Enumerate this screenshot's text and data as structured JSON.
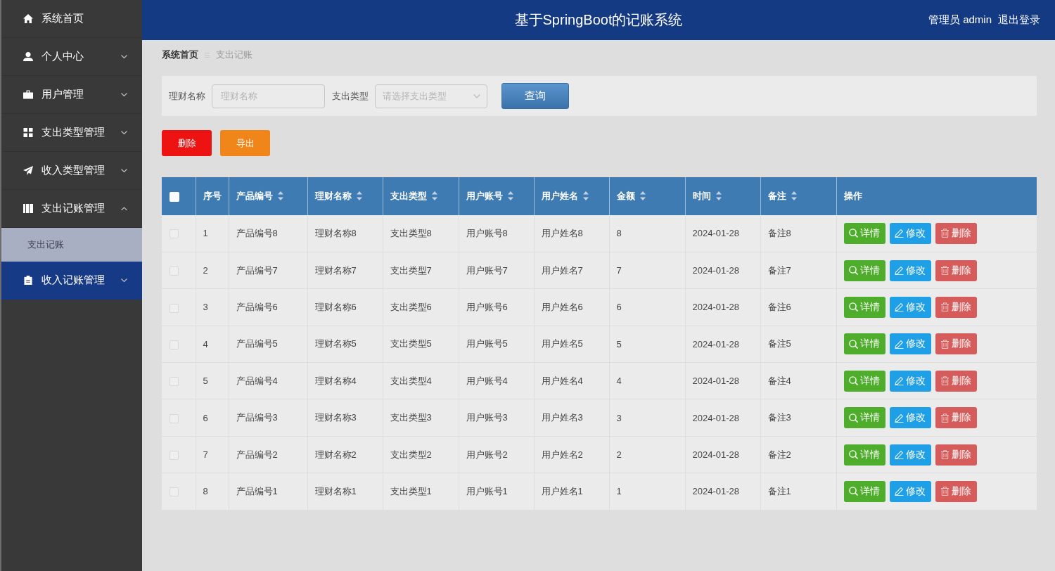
{
  "sidebar": {
    "items": [
      {
        "label": "系统首页",
        "kind": "link",
        "hovered": false
      },
      {
        "label": "个人中心",
        "kind": "menu",
        "expanded": false,
        "hovered": false
      },
      {
        "label": "用户管理",
        "kind": "menu",
        "expanded": false,
        "hovered": false
      },
      {
        "label": "支出类型管理",
        "kind": "menu",
        "expanded": false,
        "hovered": false
      },
      {
        "label": "收入类型管理",
        "kind": "menu",
        "expanded": false,
        "hovered": false
      },
      {
        "label": "支出记账管理",
        "kind": "menu",
        "expanded": true,
        "hovered": false,
        "children": [
          {
            "label": "支出记账",
            "selected": true
          }
        ]
      },
      {
        "label": "收入记账管理",
        "kind": "menu",
        "expanded": false,
        "hovered": true
      }
    ]
  },
  "header": {
    "title": "基于SpringBoot的记账系统",
    "user": "管理员 admin",
    "logout": "退出登录"
  },
  "breadcrumb": [
    {
      "label": "系统首页",
      "current": false
    },
    {
      "label": "支出记账",
      "current": true
    }
  ],
  "search": {
    "fields": [
      {
        "label": "理财名称",
        "kind": "input",
        "placeholder": "理财名称"
      },
      {
        "label": "支出类型",
        "kind": "select",
        "placeholder": "请选择支出类型"
      }
    ],
    "button": "查询"
  },
  "toolbar": [
    {
      "label": "删除",
      "kind": "danger"
    },
    {
      "label": "导出",
      "kind": "warning"
    }
  ],
  "table": {
    "select_all": {
      "checked": false
    },
    "columns": [
      {
        "label": "序号",
        "sortable": false
      },
      {
        "label": "产品编号",
        "sortable": true
      },
      {
        "label": "理财名称",
        "sortable": true
      },
      {
        "label": "支出类型",
        "sortable": true
      },
      {
        "label": "用户账号",
        "sortable": true
      },
      {
        "label": "用户姓名",
        "sortable": true
      },
      {
        "label": "金额",
        "sortable": true
      },
      {
        "label": "时间",
        "sortable": true
      },
      {
        "label": "备注",
        "sortable": true
      },
      {
        "label": "操作",
        "sortable": false
      }
    ],
    "rows": [
      {
        "checked": false,
        "cells": [
          "1",
          "产品编号8",
          "理财名称8",
          "支出类型8",
          "用户账号8",
          "用户姓名8",
          "8",
          "2024-01-28",
          "备注8"
        ],
        "actions": [
          {
            "label": "详情",
            "kind": "detail"
          },
          {
            "label": "修改",
            "kind": "edit"
          },
          {
            "label": "删除",
            "kind": "delete"
          }
        ]
      },
      {
        "checked": false,
        "cells": [
          "2",
          "产品编号7",
          "理财名称7",
          "支出类型7",
          "用户账号7",
          "用户姓名7",
          "7",
          "2024-01-28",
          "备注7"
        ],
        "actions": [
          {
            "label": "详情",
            "kind": "detail"
          },
          {
            "label": "修改",
            "kind": "edit"
          },
          {
            "label": "删除",
            "kind": "delete"
          }
        ]
      },
      {
        "checked": false,
        "cells": [
          "3",
          "产品编号6",
          "理财名称6",
          "支出类型6",
          "用户账号6",
          "用户姓名6",
          "6",
          "2024-01-28",
          "备注6"
        ],
        "actions": [
          {
            "label": "详情",
            "kind": "detail"
          },
          {
            "label": "修改",
            "kind": "edit"
          },
          {
            "label": "删除",
            "kind": "delete"
          }
        ]
      },
      {
        "checked": false,
        "cells": [
          "4",
          "产品编号5",
          "理财名称5",
          "支出类型5",
          "用户账号5",
          "用户姓名5",
          "5",
          "2024-01-28",
          "备注5"
        ],
        "actions": [
          {
            "label": "详情",
            "kind": "detail"
          },
          {
            "label": "修改",
            "kind": "edit"
          },
          {
            "label": "删除",
            "kind": "delete"
          }
        ]
      },
      {
        "checked": false,
        "cells": [
          "5",
          "产品编号4",
          "理财名称4",
          "支出类型4",
          "用户账号4",
          "用户姓名4",
          "4",
          "2024-01-28",
          "备注4"
        ],
        "actions": [
          {
            "label": "详情",
            "kind": "detail"
          },
          {
            "label": "修改",
            "kind": "edit"
          },
          {
            "label": "删除",
            "kind": "delete"
          }
        ]
      },
      {
        "checked": false,
        "cells": [
          "6",
          "产品编号3",
          "理财名称3",
          "支出类型3",
          "用户账号3",
          "用户姓名3",
          "3",
          "2024-01-28",
          "备注3"
        ],
        "actions": [
          {
            "label": "详情",
            "kind": "detail"
          },
          {
            "label": "修改",
            "kind": "edit"
          },
          {
            "label": "删除",
            "kind": "delete"
          }
        ]
      },
      {
        "checked": false,
        "cells": [
          "7",
          "产品编号2",
          "理财名称2",
          "支出类型2",
          "用户账号2",
          "用户姓名2",
          "2",
          "2024-01-28",
          "备注2"
        ],
        "actions": [
          {
            "label": "详情",
            "kind": "detail"
          },
          {
            "label": "修改",
            "kind": "edit"
          },
          {
            "label": "删除",
            "kind": "delete"
          }
        ]
      },
      {
        "checked": false,
        "cells": [
          "8",
          "产品编号1",
          "理财名称1",
          "支出类型1",
          "用户账号1",
          "用户姓名1",
          "1",
          "2024-01-28",
          "备注1"
        ],
        "actions": [
          {
            "label": "详情",
            "kind": "detail"
          },
          {
            "label": "修改",
            "kind": "edit"
          },
          {
            "label": "删除",
            "kind": "delete"
          }
        ]
      }
    ]
  }
}
